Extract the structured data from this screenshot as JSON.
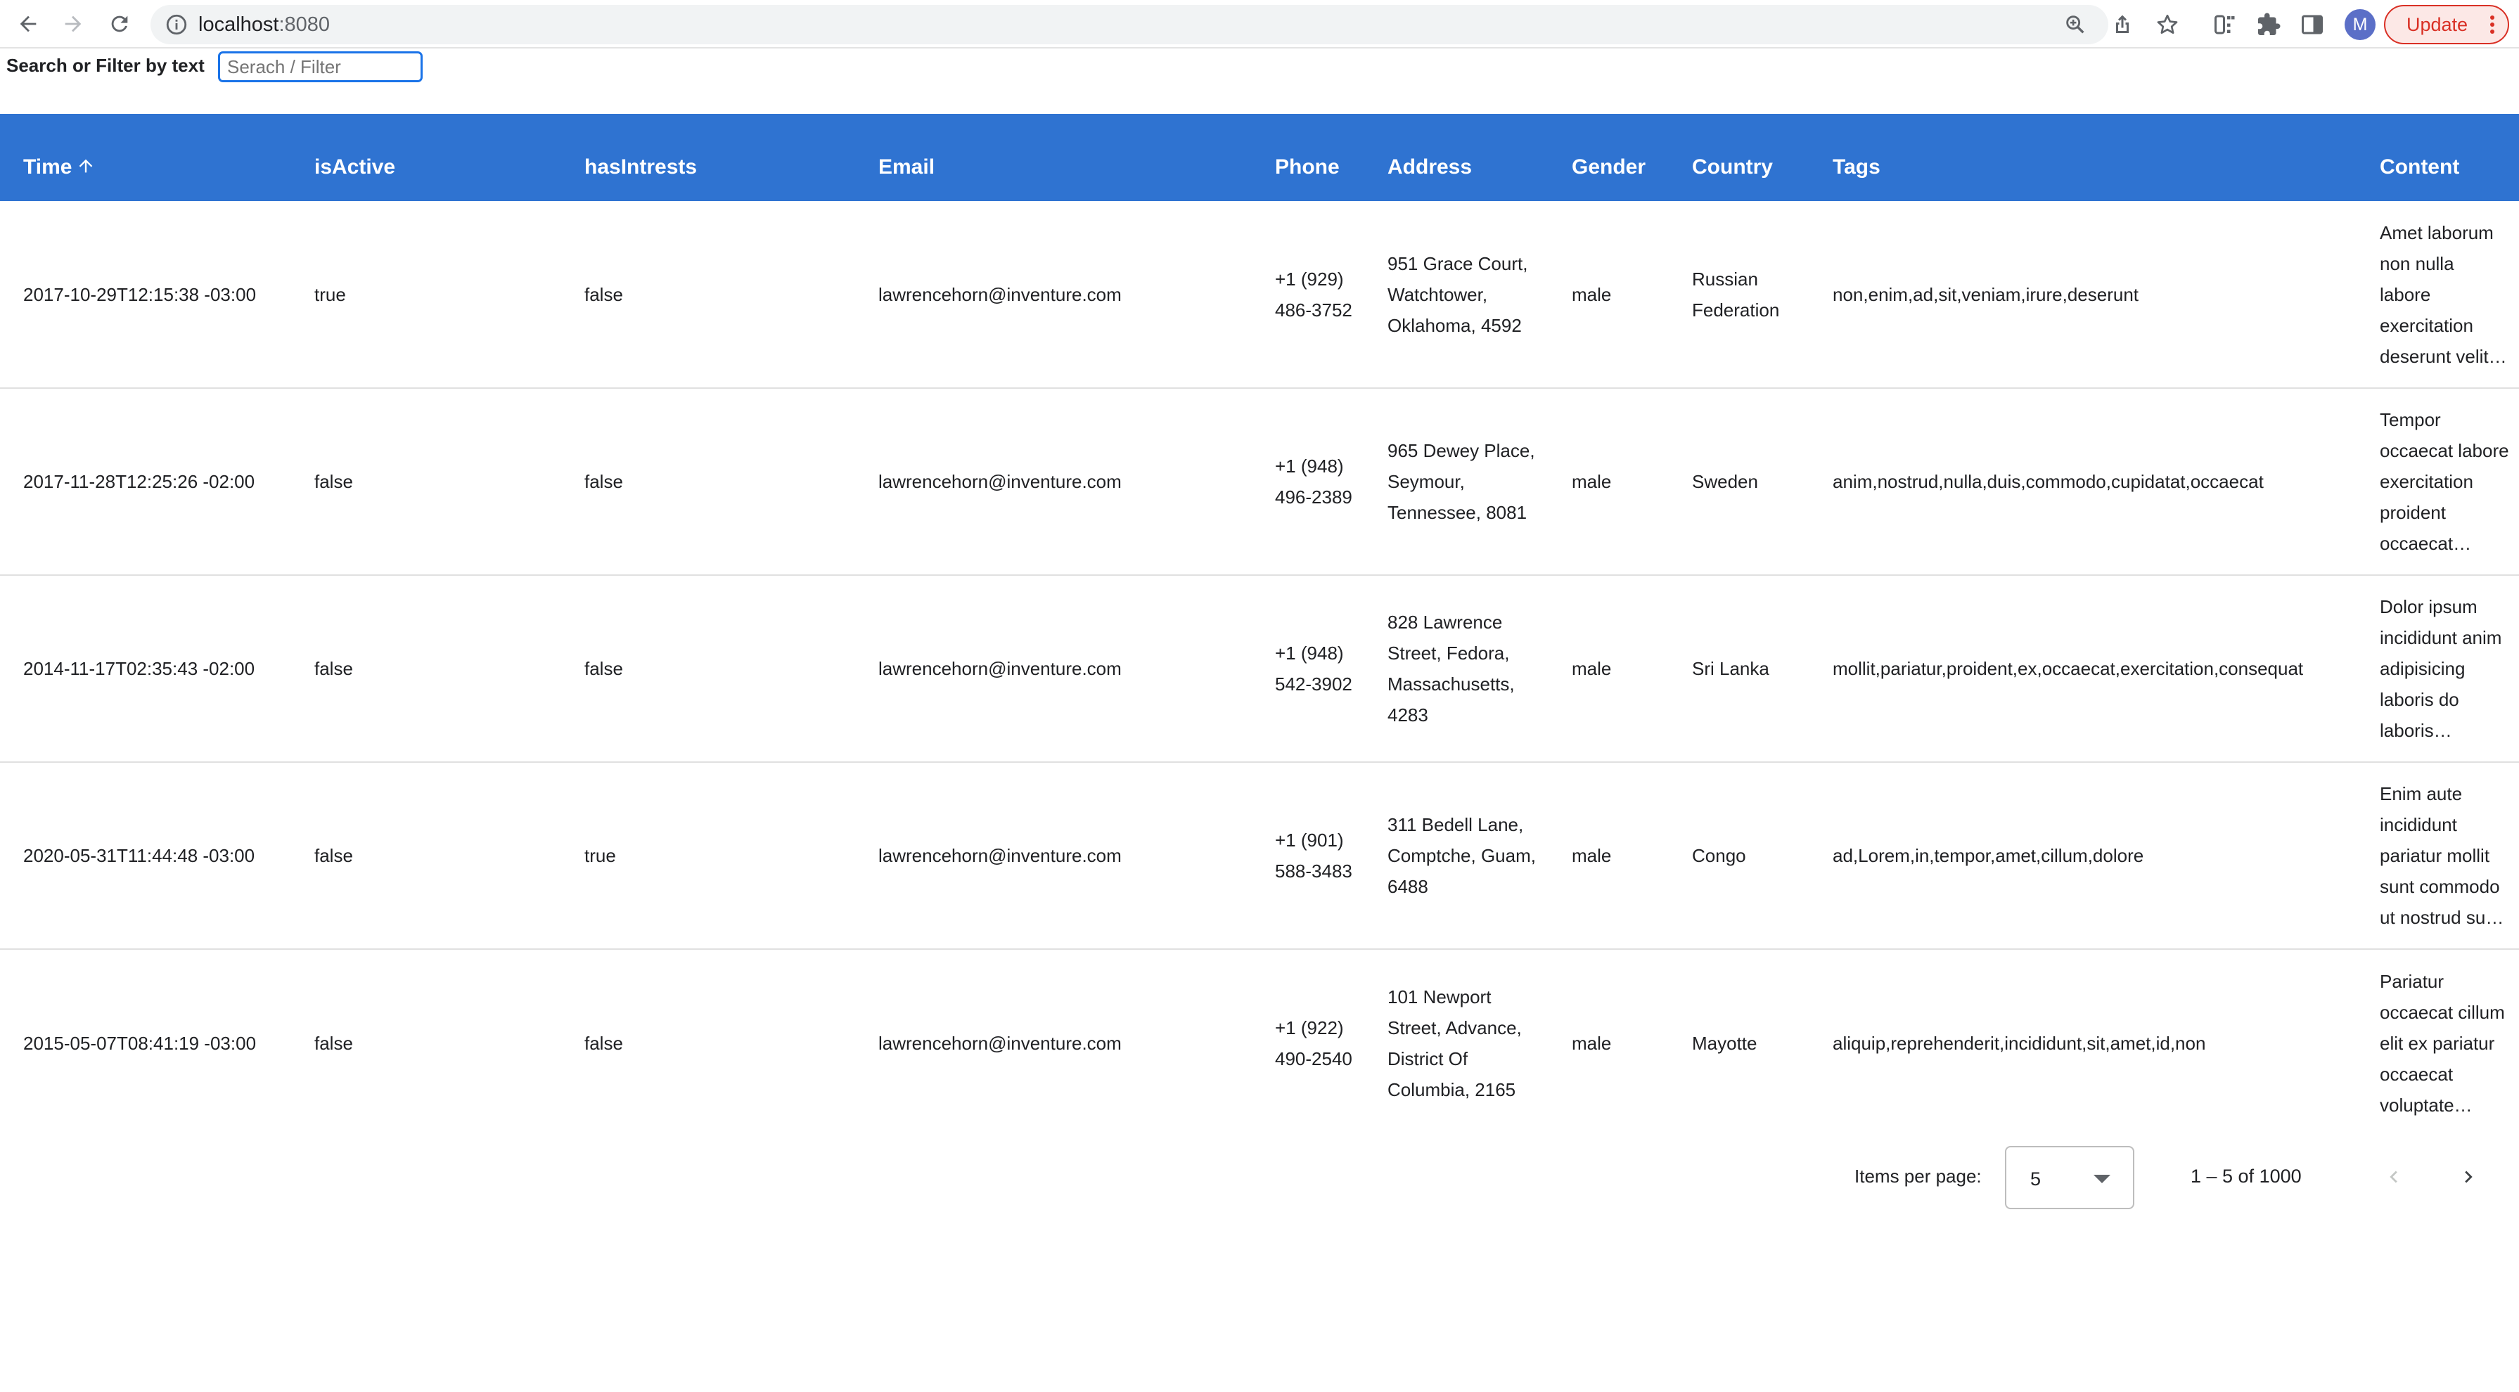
{
  "browser": {
    "url_host": "localhost",
    "url_port": ":8080",
    "avatar_initial": "M",
    "update_label": "Update"
  },
  "filter": {
    "label": "Search or Filter by text",
    "placeholder": "Serach / Filter",
    "value": ""
  },
  "table": {
    "columns": [
      "Time",
      "isActive",
      "hasIntrests",
      "Email",
      "Phone",
      "Address",
      "Gender",
      "Country",
      "Tags",
      "Content"
    ],
    "sort": {
      "column": "Time",
      "direction": "ascending"
    },
    "rows": [
      {
        "time": "2017-10-29T12:15:38 -03:00",
        "isActive": "true",
        "hasIntrests": "false",
        "email": "lawrencehorn@inventure.com",
        "phone": "+1 (929) 486-3752",
        "address": "951 Grace Court, Watchtower, Oklahoma, 4592",
        "gender": "male",
        "country": "Russian Federation",
        "tags": "non,enim,ad,sit,veniam,irure,deserunt",
        "content": "Amet laborum non nulla labore exercitation deserunt velit…"
      },
      {
        "time": "2017-11-28T12:25:26 -02:00",
        "isActive": "false",
        "hasIntrests": "false",
        "email": "lawrencehorn@inventure.com",
        "phone": "+1 (948) 496-2389",
        "address": "965 Dewey Place, Seymour, Tennessee, 8081",
        "gender": "male",
        "country": "Sweden",
        "tags": "anim,nostrud,nulla,duis,commodo,cupidatat,occaecat",
        "content": "Tempor occaecat labore exercitation proident occaecat…"
      },
      {
        "time": "2014-11-17T02:35:43 -02:00",
        "isActive": "false",
        "hasIntrests": "false",
        "email": "lawrencehorn@inventure.com",
        "phone": "+1 (948) 542-3902",
        "address": "828 Lawrence Street, Fedora, Massachusetts, 4283",
        "gender": "male",
        "country": "Sri Lanka",
        "tags": "mollit,pariatur,proident,ex,occaecat,exercitation,consequat",
        "content": "Dolor ipsum incididunt anim adipisicing laboris do laboris…"
      },
      {
        "time": "2020-05-31T11:44:48 -03:00",
        "isActive": "false",
        "hasIntrests": "true",
        "email": "lawrencehorn@inventure.com",
        "phone": "+1 (901) 588-3483",
        "address": "311 Bedell Lane, Comptche, Guam, 6488",
        "gender": "male",
        "country": "Congo",
        "tags": "ad,Lorem,in,tempor,amet,cillum,dolore",
        "content": "Enim aute incididunt pariatur mollit sunt commodo ut nostrud su…"
      },
      {
        "time": "2015-05-07T08:41:19 -03:00",
        "isActive": "false",
        "hasIntrests": "false",
        "email": "lawrencehorn@inventure.com",
        "phone": "+1 (922) 490-2540",
        "address": "101 Newport Street, Advance, District Of Columbia, 2165",
        "gender": "male",
        "country": "Mayotte",
        "tags": "aliquip,reprehenderit,incididunt,sit,amet,id,non",
        "content": "Pariatur occaecat cillum elit ex pariatur occaecat voluptate…"
      }
    ]
  },
  "paginator": {
    "items_per_page_label": "Items per page:",
    "items_per_page_value": "5",
    "range_label": "1 – 5 of 1000"
  },
  "icons": {
    "back": "arrow-left-icon",
    "forward": "arrow-right-icon",
    "reload": "reload-icon",
    "info": "info-icon",
    "zoom": "zoom-icon",
    "share": "share-icon",
    "bookmark": "star-icon",
    "extension-c": "extension-icon",
    "extensions": "puzzle-icon",
    "side-panel": "side-panel-icon",
    "menu": "more-vert-icon",
    "sort": "arrow-up-icon",
    "dropdown": "caret-down-icon",
    "prev-page": "chevron-left-icon",
    "next-page": "chevron-right-icon"
  },
  "colors": {
    "header_bg": "#2f73d1",
    "header_text": "#ffffff",
    "focus_outline": "#1a73e8",
    "update_button": "#d93025"
  }
}
